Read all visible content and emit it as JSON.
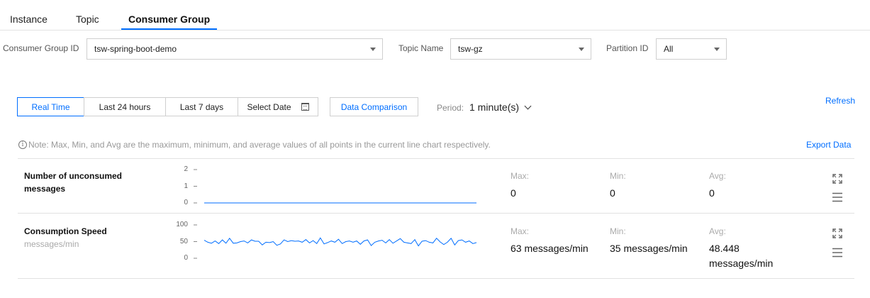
{
  "tabs": [
    {
      "label": "Instance",
      "active": false
    },
    {
      "label": "Topic",
      "active": false
    },
    {
      "label": "Consumer Group",
      "active": true
    }
  ],
  "filters": {
    "consumer_group_label": "Consumer Group ID",
    "consumer_group_value": "tsw-spring-boot-demo",
    "topic_label": "Topic Name",
    "topic_value": "tsw-gz",
    "partition_label": "Partition ID",
    "partition_value": "All"
  },
  "time_range": {
    "buttons": [
      "Real Time",
      "Last 24 hours",
      "Last 7 days",
      "Select Date"
    ],
    "active": "Real Time",
    "compare_label": "Data Comparison",
    "period_label": "Period:",
    "period_value": "1 minute(s)",
    "refresh_label": "Refresh"
  },
  "note": "Note: Max, Min, and Avg are the maximum, minimum, and average values of all points in the current line chart respectively.",
  "export_label": "Export Data",
  "accent_color": "#006eff",
  "metrics": [
    {
      "title": "Number of unconsumed messages",
      "subtitle": "",
      "yticks": [
        "2",
        "1",
        "0"
      ],
      "max_label": "Max:",
      "max": "0",
      "min_label": "Min:",
      "min": "0",
      "avg_label": "Avg:",
      "avg": "0"
    },
    {
      "title": "Consumption Speed",
      "subtitle": "messages/min",
      "yticks": [
        "100",
        "50",
        "0"
      ],
      "max_label": "Max:",
      "max": "63 messages/min",
      "min_label": "Min:",
      "min": "35 messages/min",
      "avg_label": "Avg:",
      "avg": "48.448 messages/min"
    }
  ],
  "chart_data": [
    {
      "type": "line",
      "ylim": [
        0,
        2
      ],
      "series": [
        {
          "values": [
            0,
            0,
            0,
            0,
            0,
            0,
            0,
            0,
            0,
            0,
            0,
            0,
            0,
            0,
            0,
            0,
            0,
            0,
            0,
            0,
            0,
            0,
            0,
            0,
            0,
            0,
            0,
            0,
            0,
            0,
            0,
            0,
            0,
            0,
            0,
            0,
            0,
            0,
            0,
            0,
            0,
            0,
            0,
            0,
            0,
            0,
            0,
            0,
            0,
            0,
            0,
            0,
            0,
            0,
            0,
            0,
            0,
            0,
            0,
            0
          ]
        }
      ]
    },
    {
      "type": "line",
      "ylim": [
        0,
        100
      ],
      "series": [
        {
          "values": [
            54,
            48,
            45,
            52,
            44,
            55,
            45,
            60,
            45,
            46,
            50,
            52,
            46,
            55,
            51,
            51,
            40,
            48,
            47,
            50,
            39,
            43,
            55,
            50,
            53,
            51,
            52,
            48,
            56,
            46,
            53,
            44,
            61,
            43,
            47,
            52,
            48,
            57,
            44,
            50,
            52,
            48,
            52,
            42,
            52,
            55,
            38,
            48,
            52,
            54,
            46,
            56,
            45,
            52,
            59,
            48,
            46,
            44,
            56,
            37,
            51,
            53,
            48,
            46,
            60,
            49,
            41,
            48,
            60,
            40,
            53,
            55,
            48,
            52,
            44,
            47
          ]
        }
      ]
    }
  ]
}
